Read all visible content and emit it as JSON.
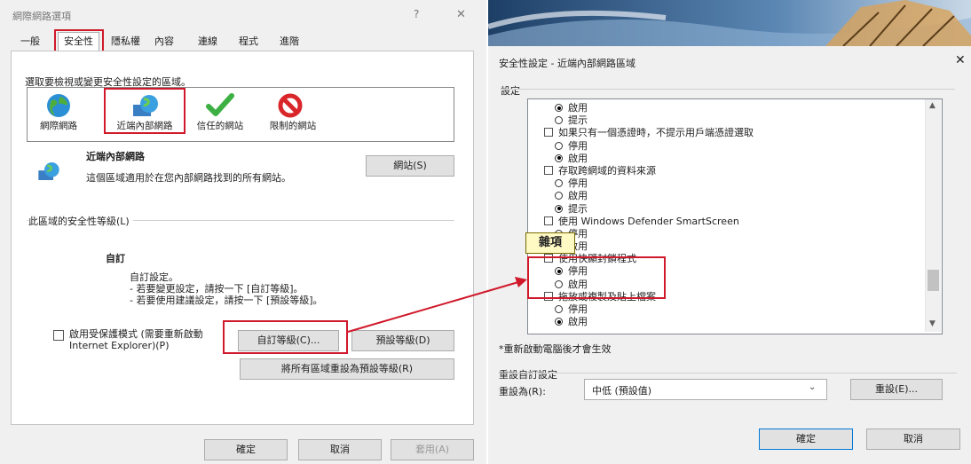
{
  "left_dialog": {
    "title": "網際網路選項",
    "help": "?",
    "close": "✕",
    "tabs": [
      "一般",
      "安全性",
      "隱私權",
      "內容",
      "連線",
      "程式",
      "進階"
    ],
    "zone_prompt": "選取要檢視或變更安全性設定的區域。",
    "zones": [
      "網際網路",
      "近端內部網路",
      "信任的網站",
      "限制的網站"
    ],
    "zone_title": "近端內部網路",
    "zone_desc": "這個區域適用於在您內部網路找到的所有網站。",
    "sites_button": "網站(S)",
    "security_level_label": "此區域的安全性等級(L)",
    "custom_title": "自訂",
    "custom_line1": "自訂設定。",
    "custom_line2": "- 若要變更設定，請按一下 [自訂等級]。",
    "custom_line3": "- 若要使用建議設定，請按一下 [預設等級]。",
    "protected_mode": "啟用受保護模式 (需要重新啟動 Internet Explorer)(P)",
    "protected_line1": "啟用受保護模式 (需要重新啟動",
    "protected_line2": "Internet Explorer)(P)",
    "custom_level_button": "自訂等級(C)...",
    "default_level_button": "預設等級(D)",
    "reset_all_button": "將所有區域重設為預設等級(R)",
    "ok": "確定",
    "cancel": "取消",
    "apply": "套用(A)"
  },
  "right_dialog": {
    "title": "安全性設定 - 近端內部網路區域",
    "close": "✕",
    "settings_label": "設定",
    "items": [
      {
        "type": "radio",
        "label": "啟用",
        "checked": true
      },
      {
        "type": "radio",
        "label": "提示",
        "checked": false
      },
      {
        "type": "check",
        "label": "如果只有一個憑證時，不提示用戶端憑證選取"
      },
      {
        "type": "radio",
        "label": "停用",
        "checked": false
      },
      {
        "type": "radio",
        "label": "啟用",
        "checked": true
      },
      {
        "type": "check",
        "label": "存取跨網域的資料來源"
      },
      {
        "type": "radio",
        "label": "停用",
        "checked": false
      },
      {
        "type": "radio",
        "label": "啟用",
        "checked": false
      },
      {
        "type": "radio",
        "label": "提示",
        "checked": true
      },
      {
        "type": "check",
        "label": "使用 Windows Defender SmartScreen"
      },
      {
        "type": "radio",
        "label": "停用",
        "checked": false
      },
      {
        "type": "radio",
        "label": "啟用",
        "checked": true
      },
      {
        "type": "check",
        "label": "使用快顯封鎖程式"
      },
      {
        "type": "radio",
        "label": "停用",
        "checked": true
      },
      {
        "type": "radio",
        "label": "啟用",
        "checked": false
      },
      {
        "type": "check",
        "label": "拖放或複製及貼上檔案"
      },
      {
        "type": "radio",
        "label": "停用",
        "checked": false
      },
      {
        "type": "radio",
        "label": "啟用",
        "checked": true
      }
    ],
    "tooltip": "雜項",
    "restart_note": "*重新啟動電腦後才會生效",
    "reset_group": "重設自訂設定",
    "reset_to_label": "重設為(R):",
    "reset_to_value": "中低 (預設值)",
    "reset_button": "重設(E)...",
    "ok": "確定",
    "cancel": "取消"
  },
  "colors": {
    "highlight_red": "#d0192b",
    "accent_blue": "#0078d7"
  }
}
